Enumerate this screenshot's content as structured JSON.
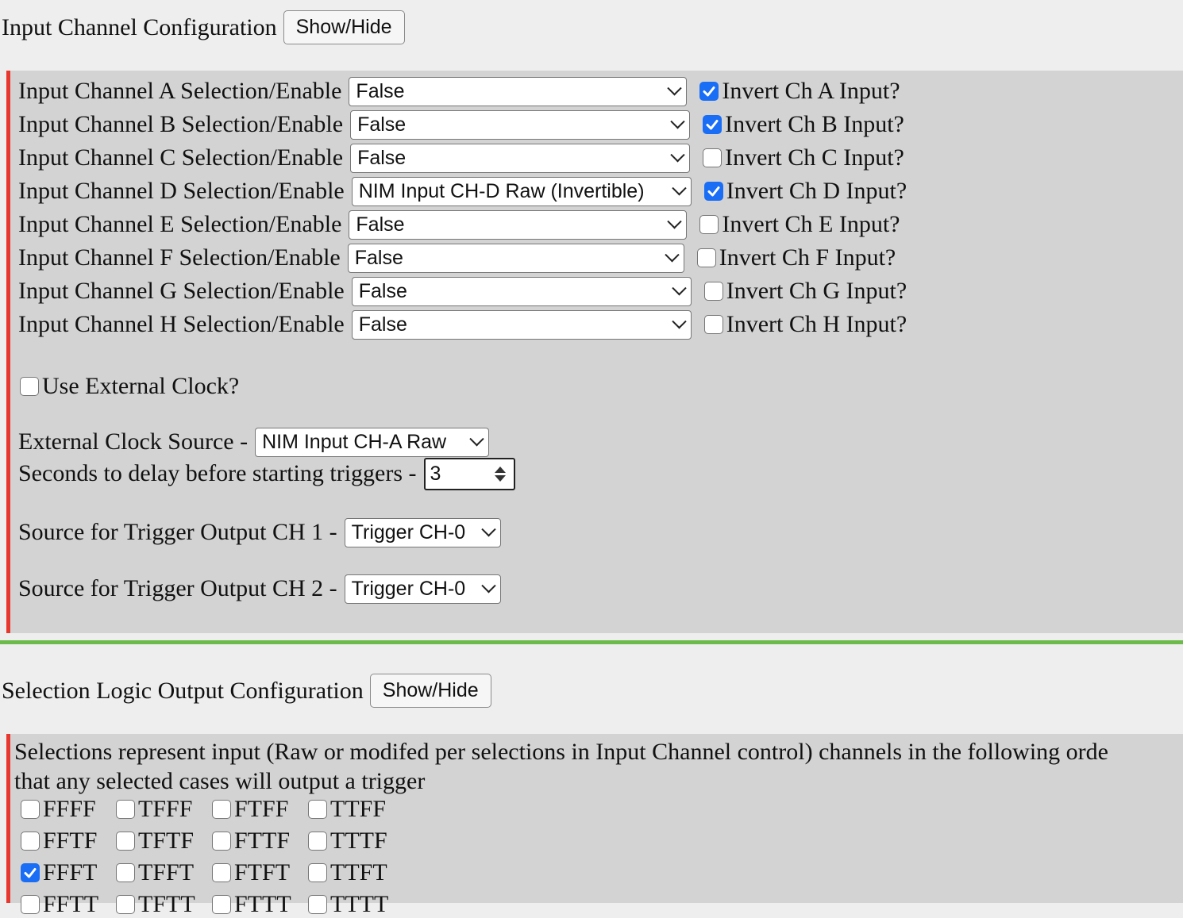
{
  "input_section": {
    "title": "Input Channel Configuration",
    "toggle_label": "Show/Hide",
    "channels": [
      {
        "label": "Input Channel A Selection/Enable",
        "selected": "False",
        "invert_label": "Invert Ch A Input?",
        "invert": true
      },
      {
        "label": "Input Channel B Selection/Enable",
        "selected": "False",
        "invert_label": "Invert Ch B Input?",
        "invert": true
      },
      {
        "label": "Input Channel C Selection/Enable",
        "selected": "False",
        "invert_label": "Invert Ch C Input?",
        "invert": false
      },
      {
        "label": "Input Channel D Selection/Enable",
        "selected": "NIM Input CH-D Raw (Invertible)",
        "invert_label": "Invert Ch D Input?",
        "invert": true
      },
      {
        "label": "Input Channel E Selection/Enable",
        "selected": "False",
        "invert_label": "Invert Ch E Input?",
        "invert": false
      },
      {
        "label": "Input Channel F Selection/Enable",
        "selected": "False",
        "invert_label": "Invert Ch F Input?",
        "invert": false
      },
      {
        "label": "Input Channel G Selection/Enable",
        "selected": "False",
        "invert_label": "Invert Ch G Input?",
        "invert": false
      },
      {
        "label": "Input Channel H Selection/Enable",
        "selected": "False",
        "invert_label": "Invert Ch H Input?",
        "invert": false
      }
    ],
    "external_clock_label": "Use External Clock?",
    "external_clock_checked": false,
    "clock_source_label": "External Clock Source -",
    "clock_source_value": "NIM Input CH-A Raw",
    "delay_label": "Seconds to delay before starting triggers -",
    "delay_value": "3",
    "trigger1_label": "Source for Trigger Output CH 1 -",
    "trigger1_value": "Trigger CH-0",
    "trigger2_label": "Source for Trigger Output CH 2 -",
    "trigger2_value": "Trigger CH-0"
  },
  "logic_section": {
    "title": "Selection Logic Output Configuration",
    "toggle_label": "Show/Hide",
    "description_line1": "Selections represent input (Raw or modifed per selections in Input Channel control) channels in the following orde",
    "description_line2": "that any selected cases will output a trigger",
    "rows": [
      [
        {
          "label": "FFFF",
          "checked": false
        },
        {
          "label": "TFFF",
          "checked": false
        },
        {
          "label": "FTFF",
          "checked": false
        },
        {
          "label": "TTFF",
          "checked": false
        }
      ],
      [
        {
          "label": "FFTF",
          "checked": false
        },
        {
          "label": "TFTF",
          "checked": false
        },
        {
          "label": "FTTF",
          "checked": false
        },
        {
          "label": "TTTF",
          "checked": false
        }
      ],
      [
        {
          "label": "FFFT",
          "checked": true
        },
        {
          "label": "TFFT",
          "checked": false
        },
        {
          "label": "FTFT",
          "checked": false
        },
        {
          "label": "TTFT",
          "checked": false
        }
      ],
      [
        {
          "label": "FFTT",
          "checked": false
        },
        {
          "label": "TFTT",
          "checked": false
        },
        {
          "label": "FTTT",
          "checked": false
        },
        {
          "label": "TTTT",
          "checked": false
        }
      ]
    ]
  },
  "colors": {
    "panel_accent": "#e8372c",
    "divider": "#6cbb4a",
    "checkbox_checked": "#1a6ef5"
  }
}
